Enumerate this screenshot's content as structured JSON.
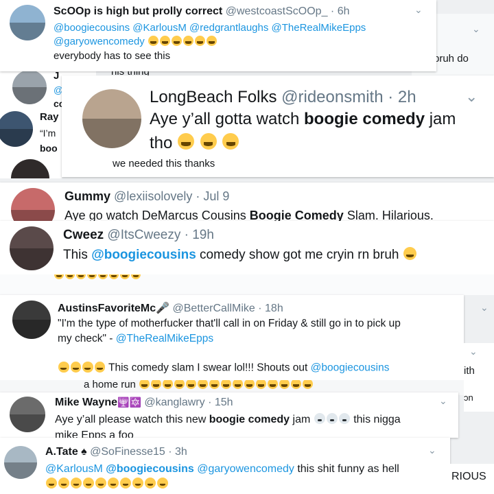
{
  "tweets": [
    {
      "name": "ScOOp is high but prolly correct",
      "handle": "@westcoastScOOp_",
      "time": "6h",
      "mentions_line1": "@boogiecousins @KarlousM @redgrantlaughs @TheRealMikeEpps",
      "mentions_line2": "@garyowencomedy",
      "text": "everybody has to see this"
    },
    {
      "partial_right_text": "bruh do",
      "partial_text": "his thing",
      "partial_name": "J",
      "partial_mention": "@",
      "partial_co": "co"
    },
    {
      "partial_name": "Ray",
      "partial_quote": "“I’m",
      "partial_boo": "boo"
    },
    {
      "name": "LongBeach Folks",
      "handle": "@rideonsmith",
      "time": "2h",
      "text_before": "Aye y’all gotta watch ",
      "text_bold": "boogie comedy",
      "text_after": " jam",
      "text_line2": "tho",
      "reply_snippet": "we needed this thanks"
    },
    {
      "name": "Gummy",
      "handle": "@lexiisolovely",
      "time": "Jul 9",
      "text_before": "Aye go watch DeMarcus Cousins ",
      "text_bold": "Boogie Comedy",
      "text_after": " Slam. Hilarious."
    },
    {
      "name": "Cweez",
      "handle": "@ItsCweezy",
      "time": "19h",
      "text_before": "This ",
      "text_link": "@boogiecousins",
      "text_after": " comedy show got me cryin rn bruh"
    },
    {
      "name": "AustinsFavoriteMc",
      "handle": "@BetterCallMike",
      "time": "18h",
      "quote_line1": "\"I'm the type of motherfucker that'll call in on Friday & still go in to pick up",
      "quote_line2_before": "my check\" - ",
      "quote_line2_link": "@TheRealMikeEpps",
      "line3_text": " This comedy slam I swear lol!!! Shouts out ",
      "line3_link": "@boogiecousins"
    },
    {
      "partial_text": "a home run",
      "partial_right_1": "ith",
      "partial_right_2": "ɔn"
    },
    {
      "name": "Mike Wayne",
      "handle": "@kanglawry",
      "time": "15h",
      "text_before": "Aye y’all please watch this new ",
      "text_bold": "boogie comedy",
      "text_after": " jam",
      "text_end": " this nigga",
      "text_line2": "mike Epps a foo"
    },
    {
      "name": "A.Tate",
      "handle": "@SoFinesse15",
      "time": "3h",
      "link1": "@KarlousM",
      "link2": "@boogiecousins",
      "link3": "@garyowencomedy",
      "text_after": " this shit funny as hell",
      "partial_right": "RIOUS"
    }
  ],
  "separator": "·",
  "colors": {
    "link": "#1b95e0",
    "handle": "#657786",
    "text": "#14171a",
    "emoji": "#ffcc4d"
  },
  "icons": {
    "chevron": "chevron-down-icon",
    "emoji": "face-with-tears-of-joy-icon",
    "skull": "skull-icon",
    "microphone": "microphone-icon",
    "spade": "spade-icon"
  }
}
